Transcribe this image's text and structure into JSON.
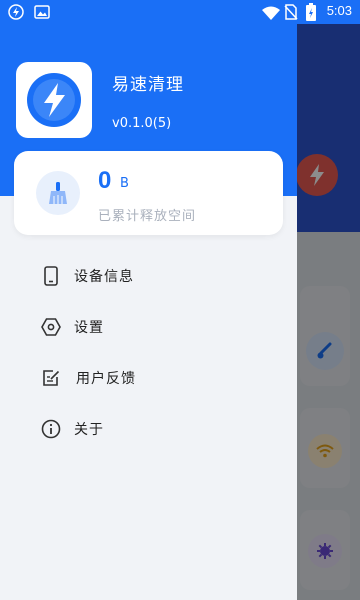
{
  "status_bar": {
    "time": "5:03",
    "icons": [
      "app-notification-icon",
      "image-icon",
      "wifi-icon",
      "no-sim-icon",
      "battery-icon"
    ]
  },
  "drawer": {
    "app_name": "易速清理",
    "version": "v0.1.0(5)",
    "stats": {
      "value": "0",
      "unit": "B",
      "caption": "已累计释放空间"
    },
    "menu": [
      {
        "label": "设备信息",
        "icon": "phone-icon"
      },
      {
        "label": "设置",
        "icon": "settings-icon"
      },
      {
        "label": "用户反馈",
        "icon": "feedback-icon"
      },
      {
        "label": "关于",
        "icon": "info-icon"
      }
    ]
  },
  "colors": {
    "primary": "#1a6ff6",
    "drawer_bg": "#f1f3f7",
    "caption": "#aab1bd",
    "text": "#222222"
  }
}
